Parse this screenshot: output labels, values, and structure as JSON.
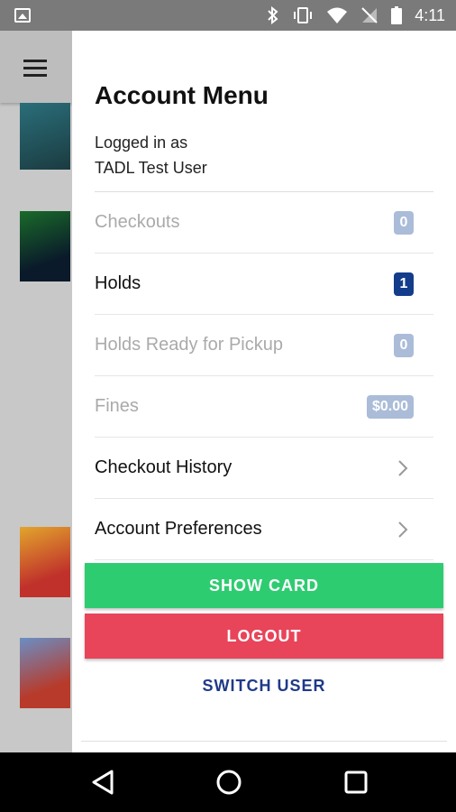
{
  "status_bar": {
    "time": "4:11"
  },
  "drawer": {
    "title": "Account Menu",
    "logged_in_prefix": "Logged in as",
    "user_name": "TADL Test User",
    "items": [
      {
        "label": "Checkouts",
        "badge": "0",
        "state": "disabled"
      },
      {
        "label": "Holds",
        "badge": "1",
        "state": "active"
      },
      {
        "label": "Holds Ready for Pickup",
        "badge": "0",
        "state": "disabled"
      },
      {
        "label": "Fines",
        "badge": "$0.00",
        "state": "disabled"
      },
      {
        "label": "Checkout History",
        "icon": "chevron-right-icon",
        "state": "active"
      },
      {
        "label": "Account Preferences",
        "icon": "chevron-right-icon",
        "state": "active"
      }
    ],
    "show_card_label": "SHOW CARD",
    "logout_label": "LOGOUT",
    "switch_user_label": "SWITCH USER"
  },
  "colors": {
    "show_card": "#2ecc71",
    "logout": "#e8445a",
    "badge_active": "#133d8b",
    "badge_inactive": "#aabcd8",
    "switch_user": "#1f3a8a"
  }
}
